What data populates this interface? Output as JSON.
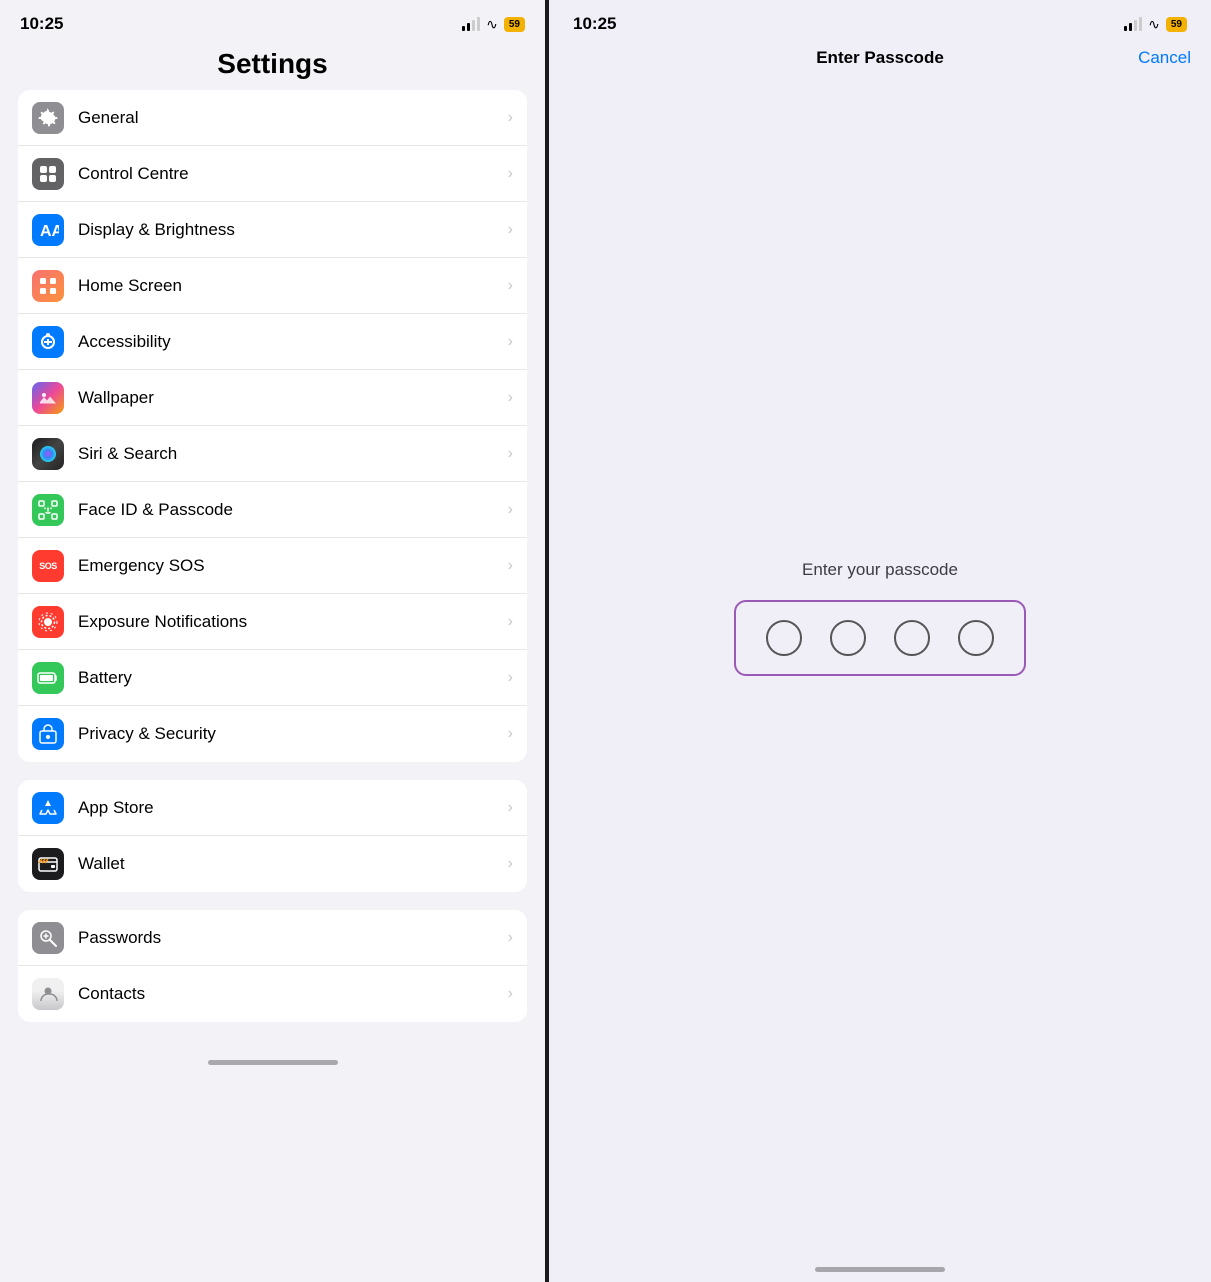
{
  "left": {
    "time": "10:25",
    "battery": "59",
    "title": "Settings",
    "groups": [
      {
        "id": "group1",
        "items": [
          {
            "id": "general",
            "label": "General",
            "icon_type": "general",
            "icon_char": "⚙",
            "icon_bg": "#8e8e93"
          },
          {
            "id": "control-centre",
            "label": "Control Centre",
            "icon_type": "control",
            "icon_char": "⊞",
            "icon_bg": "#636366"
          },
          {
            "id": "display-brightness",
            "label": "Display & Brightness",
            "icon_type": "display",
            "icon_char": "AA",
            "icon_bg": "#007aff"
          },
          {
            "id": "home-screen",
            "label": "Home Screen",
            "icon_type": "homescreen",
            "icon_char": "⊞",
            "icon_bg": "#ff6b6b"
          },
          {
            "id": "accessibility",
            "label": "Accessibility",
            "icon_type": "accessibility",
            "icon_char": "♿",
            "icon_bg": "#007aff"
          },
          {
            "id": "wallpaper",
            "label": "Wallpaper",
            "icon_type": "wallpaper",
            "icon_char": "❋",
            "icon_bg": "#5ac8fa"
          },
          {
            "id": "siri-search",
            "label": "Siri & Search",
            "icon_type": "siri",
            "icon_char": "◉",
            "icon_bg": "#333"
          },
          {
            "id": "face-id-passcode",
            "label": "Face ID & Passcode",
            "icon_type": "faceid",
            "icon_char": "😊",
            "icon_bg": "#34c759",
            "has_arrow": true
          },
          {
            "id": "emergency-sos",
            "label": "Emergency SOS",
            "icon_type": "sos",
            "icon_char": "SOS",
            "icon_bg": "#ff3b30"
          },
          {
            "id": "exposure-notifications",
            "label": "Exposure Notifications",
            "icon_type": "exposure",
            "icon_char": "◉",
            "icon_bg": "#ff3b30"
          },
          {
            "id": "battery",
            "label": "Battery",
            "icon_type": "battery",
            "icon_char": "🔋",
            "icon_bg": "#34c759"
          },
          {
            "id": "privacy-security",
            "label": "Privacy & Security",
            "icon_type": "privacy",
            "icon_char": "✋",
            "icon_bg": "#007aff"
          }
        ]
      },
      {
        "id": "group2",
        "items": [
          {
            "id": "app-store",
            "label": "App Store",
            "icon_type": "appstore",
            "icon_char": "A",
            "icon_bg": "#007aff"
          },
          {
            "id": "wallet",
            "label": "Wallet",
            "icon_type": "wallet",
            "icon_char": "💳",
            "icon_bg": "#1c1c1e"
          }
        ]
      },
      {
        "id": "group3",
        "items": [
          {
            "id": "passwords",
            "label": "Passwords",
            "icon_type": "passwords",
            "icon_char": "🔑",
            "icon_bg": "#8e8e93"
          },
          {
            "id": "contacts",
            "label": "Contacts",
            "icon_type": "contacts",
            "icon_char": "👤",
            "icon_bg": "#ccc"
          }
        ]
      }
    ]
  },
  "right": {
    "time": "10:25",
    "battery": "59",
    "title": "Enter Passcode",
    "cancel_label": "Cancel",
    "passcode_prompt": "Enter your passcode",
    "circles_count": 4
  }
}
